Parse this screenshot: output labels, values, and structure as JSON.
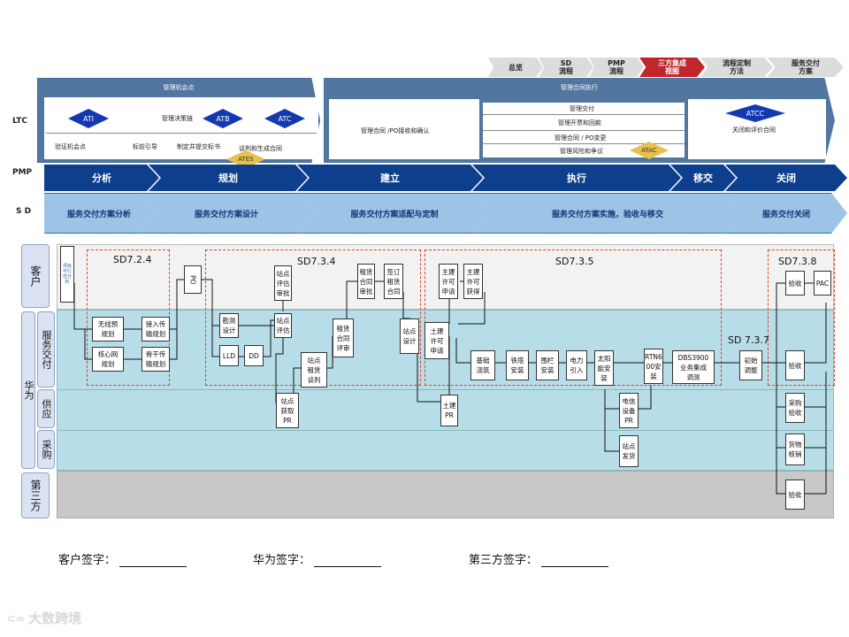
{
  "top_nav": [
    "总览",
    "SD\n流程",
    "PMP\n流程",
    "三方集成\n视图",
    "流程定制\n方法",
    "服务交付\n方案"
  ],
  "top_nav_active": 3,
  "row_labels": {
    "ltc": "LTC",
    "pmp": "PMP",
    "sd": "S D"
  },
  "ltc": {
    "left_title": "管理机会点",
    "right_title": "管理合同执行",
    "diamonds": [
      "ATI",
      "ATB",
      "ATC",
      "ATCC"
    ],
    "gold": [
      "ATES",
      "ATAC"
    ],
    "decision": "管理决策链",
    "sub_left": [
      "验证机会点",
      "标前引导",
      "制定并提交标书",
      "谈判和生成合同"
    ],
    "contract": "管理合同 /PO接收和确认",
    "mid_items": [
      "管理交付",
      "管理开票和回款",
      "管理合同 / PO变更",
      "管理风险和争议"
    ],
    "close": "关闭和评价合同"
  },
  "pmp": [
    "分析",
    "规划",
    "建立",
    "执行",
    "移交",
    "关闭"
  ],
  "sd": [
    "服务交付方案分析",
    "服务交付方案设计",
    "服务交付方案适配与定制",
    "服务交付方案实施，验收与移交",
    "服务交付关闭"
  ],
  "lanes": {
    "customer": "客户",
    "huawei": "华为",
    "service": "服务交付",
    "supply": "供应",
    "purchase": "采购",
    "third": "第三方"
  },
  "sd_labels": [
    "SD7.2.4",
    "SD7.3.4",
    "SD7.3.5",
    "SD7.3.8",
    "SD 7.3.7"
  ],
  "boxes": {
    "b1": "项目可行性分析",
    "b2": "无线预\n规划",
    "b3": "核心网\n规划",
    "b4": "接入传\n输规划",
    "b5": "骨干传\n输规划",
    "b6": "PO",
    "b7": "勘测\n设计",
    "b8": "LLD",
    "b9": "DD",
    "b10": "站点\n评估\n审批",
    "b11": "站点\n评估",
    "b12": "站点\n获取\nPR",
    "b13": "站点\n租赁\n谈判",
    "b14": "租赁\n合同\n评审",
    "b15": "租赁\n合同\n审批",
    "b16": "签订\n租赁\n合同",
    "b17": "站点\n设计",
    "b18": "主建\n许可\n申请",
    "b19": "主建\n许可\n获得",
    "b20": "土建\n许可\n申请",
    "b21": "土建\nPR",
    "b22": "基础\n浇筑",
    "b23": "铁塔\n安装",
    "b24": "围栏\n安装",
    "b25": "电力\n引入",
    "b26": "太阳\n能安\n装",
    "b27": "RTN6\n00安\n装",
    "b28": "DBS3900\n业务集成\n调测",
    "b29": "电信\n设备\nPR",
    "b30": "站点\n发货",
    "b31": "初始\n调整",
    "b32": "验收",
    "b33": "PAC",
    "b34": "验收",
    "b35": "采购\n验收",
    "b36": "货物\n核销",
    "b37": "验收"
  },
  "signatures": [
    "客户签字：",
    "华为签字：",
    "第三方签字："
  ],
  "watermark": "大数跨境"
}
